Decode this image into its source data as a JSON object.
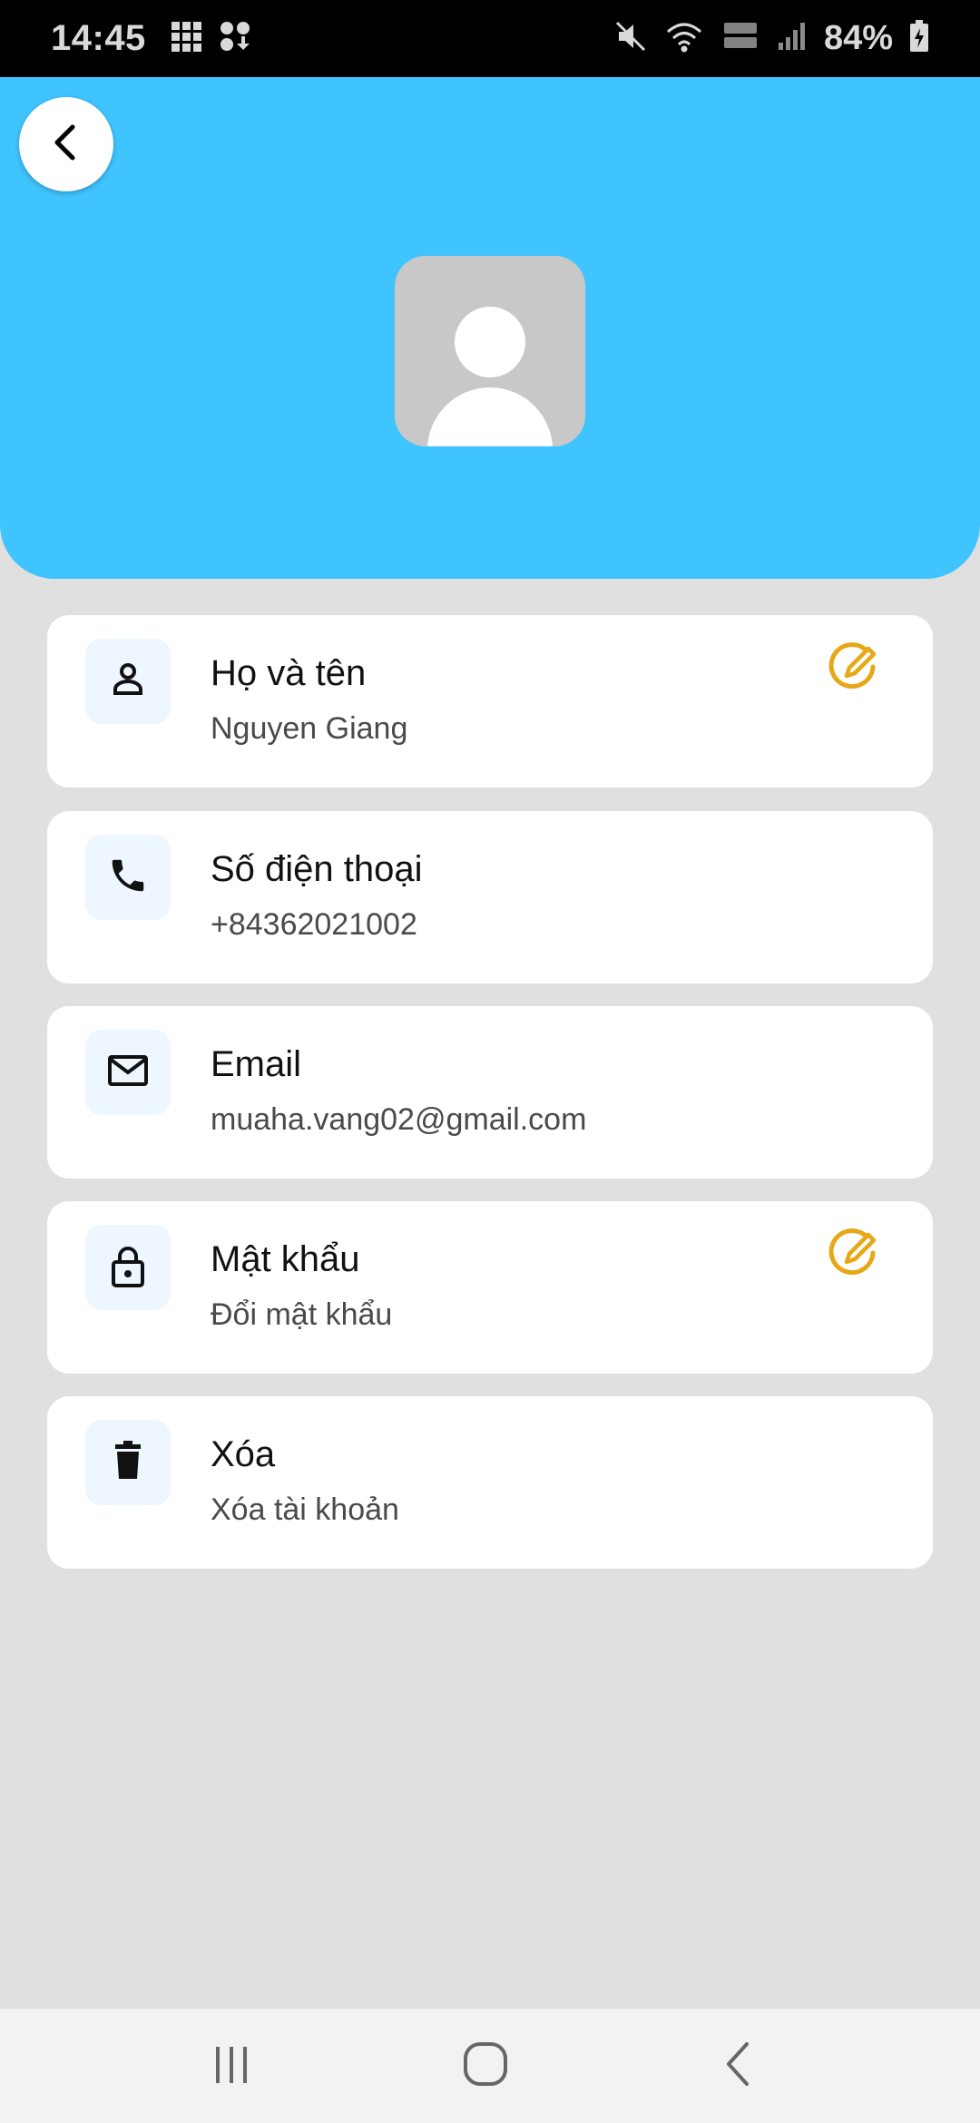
{
  "status_bar": {
    "time": "14:45",
    "battery": "84%"
  },
  "profile": {
    "fields": [
      {
        "icon": "person-icon",
        "title": "Họ và tên",
        "subtitle": "Nguyen Giang",
        "editable": true
      },
      {
        "icon": "phone-icon",
        "title": "Số điện thoại",
        "subtitle": "+84362021002",
        "editable": false
      },
      {
        "icon": "mail-icon",
        "title": "Email",
        "subtitle": "muaha.vang02@gmail.com",
        "editable": false
      },
      {
        "icon": "lock-icon",
        "title": "Mật khẩu",
        "subtitle": "Đổi mật khẩu",
        "editable": true
      },
      {
        "icon": "trash-icon",
        "title": "Xóa",
        "subtitle": "Xóa tài khoản",
        "editable": false
      }
    ]
  },
  "colors": {
    "header": "#40c4ff",
    "edit_icon": "#e6a817",
    "background": "#e0e0e0"
  }
}
